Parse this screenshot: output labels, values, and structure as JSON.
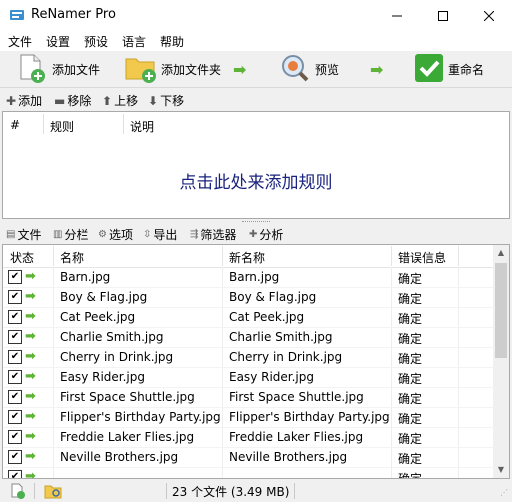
{
  "window": {
    "title": "ReNamer Pro"
  },
  "menu": [
    "文件",
    "设置",
    "预设",
    "语言",
    "帮助"
  ],
  "toolbar": {
    "add_files": "添加文件",
    "add_folders": "添加文件夹",
    "preview": "预览",
    "rename": "重命名"
  },
  "rule_actions": {
    "add": "添加",
    "remove": "移除",
    "up": "上移",
    "down": "下移"
  },
  "rules": {
    "columns": [
      "#",
      "规则",
      "说明"
    ],
    "empty_hint": "点击此处来添加规则"
  },
  "file_toolbar": [
    "文件",
    "分栏",
    "选项",
    "导出",
    "筛选器",
    "分析"
  ],
  "files": {
    "columns": [
      "状态",
      "名称",
      "新名称",
      "错误信息"
    ],
    "rows": [
      {
        "name": "Barn.jpg",
        "new_name": "Barn.jpg",
        "error": "确定"
      },
      {
        "name": "Boy & Flag.jpg",
        "new_name": "Boy & Flag.jpg",
        "error": "确定"
      },
      {
        "name": "Cat Peek.jpg",
        "new_name": "Cat Peek.jpg",
        "error": "确定"
      },
      {
        "name": "Charlie Smith.jpg",
        "new_name": "Charlie Smith.jpg",
        "error": "确定"
      },
      {
        "name": "Cherry in Drink.jpg",
        "new_name": "Cherry in Drink.jpg",
        "error": "确定"
      },
      {
        "name": "Easy Rider.jpg",
        "new_name": "Easy Rider.jpg",
        "error": "确定"
      },
      {
        "name": "First Space Shuttle.jpg",
        "new_name": "First Space Shuttle.jpg",
        "error": "确定"
      },
      {
        "name": "Flipper's Birthday Party.jpg",
        "new_name": "Flipper's Birthday Party.jpg",
        "error": "确定"
      },
      {
        "name": "Freddie Laker Flies.jpg",
        "new_name": "Freddie Laker Flies.jpg",
        "error": "确定"
      },
      {
        "name": "Neville Brothers.jpg",
        "new_name": "Neville Brothers.jpg",
        "error": "确定"
      },
      {
        "name": "",
        "new_name": "",
        "error": "确定"
      }
    ]
  },
  "status": {
    "text": "23 个文件 (3.49 MB)"
  },
  "colors": {
    "accent_green": "#5fb336",
    "hint_blue": "#1a237e",
    "rename_green": "#3aa935"
  }
}
